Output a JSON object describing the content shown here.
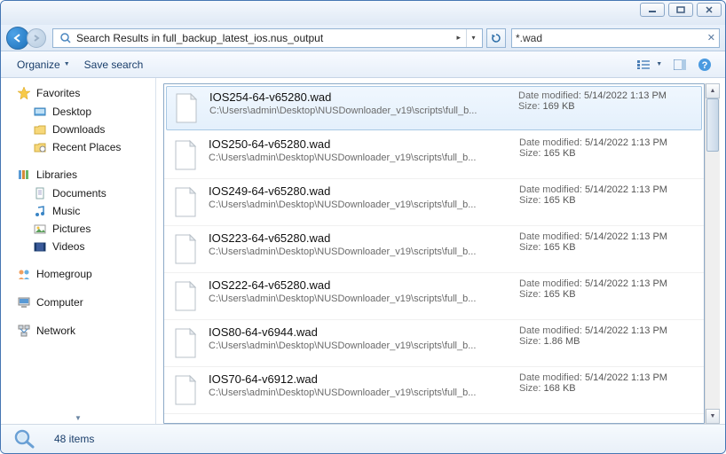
{
  "window": {
    "title": ""
  },
  "address": {
    "text": "Search Results in full_backup_latest_ios.nus_output",
    "chevron": "▸"
  },
  "search": {
    "value": "*.wad"
  },
  "toolbar": {
    "organize": "Organize",
    "save_search": "Save search"
  },
  "nav": {
    "favorites": {
      "label": "Favorites",
      "items": [
        "Desktop",
        "Downloads",
        "Recent Places"
      ]
    },
    "libraries": {
      "label": "Libraries",
      "items": [
        "Documents",
        "Music",
        "Pictures",
        "Videos"
      ]
    },
    "homegroup": {
      "label": "Homegroup"
    },
    "computer": {
      "label": "Computer"
    },
    "network": {
      "label": "Network"
    }
  },
  "meta_labels": {
    "date": "Date modified:",
    "size": "Size:"
  },
  "files": [
    {
      "name": "IOS254-64-v65280.wad",
      "path": "C:\\Users\\admin\\Desktop\\NUSDownloader_v19\\scripts\\full_b...",
      "date": "5/14/2022 1:13 PM",
      "size": "169 KB"
    },
    {
      "name": "IOS250-64-v65280.wad",
      "path": "C:\\Users\\admin\\Desktop\\NUSDownloader_v19\\scripts\\full_b...",
      "date": "5/14/2022 1:13 PM",
      "size": "165 KB"
    },
    {
      "name": "IOS249-64-v65280.wad",
      "path": "C:\\Users\\admin\\Desktop\\NUSDownloader_v19\\scripts\\full_b...",
      "date": "5/14/2022 1:13 PM",
      "size": "165 KB"
    },
    {
      "name": "IOS223-64-v65280.wad",
      "path": "C:\\Users\\admin\\Desktop\\NUSDownloader_v19\\scripts\\full_b...",
      "date": "5/14/2022 1:13 PM",
      "size": "165 KB"
    },
    {
      "name": "IOS222-64-v65280.wad",
      "path": "C:\\Users\\admin\\Desktop\\NUSDownloader_v19\\scripts\\full_b...",
      "date": "5/14/2022 1:13 PM",
      "size": "165 KB"
    },
    {
      "name": "IOS80-64-v6944.wad",
      "path": "C:\\Users\\admin\\Desktop\\NUSDownloader_v19\\scripts\\full_b...",
      "date": "5/14/2022 1:13 PM",
      "size": "1.86 MB"
    },
    {
      "name": "IOS70-64-v6912.wad",
      "path": "C:\\Users\\admin\\Desktop\\NUSDownloader_v19\\scripts\\full_b...",
      "date": "5/14/2022 1:13 PM",
      "size": "168 KB"
    }
  ],
  "status": {
    "count": "48 items"
  }
}
